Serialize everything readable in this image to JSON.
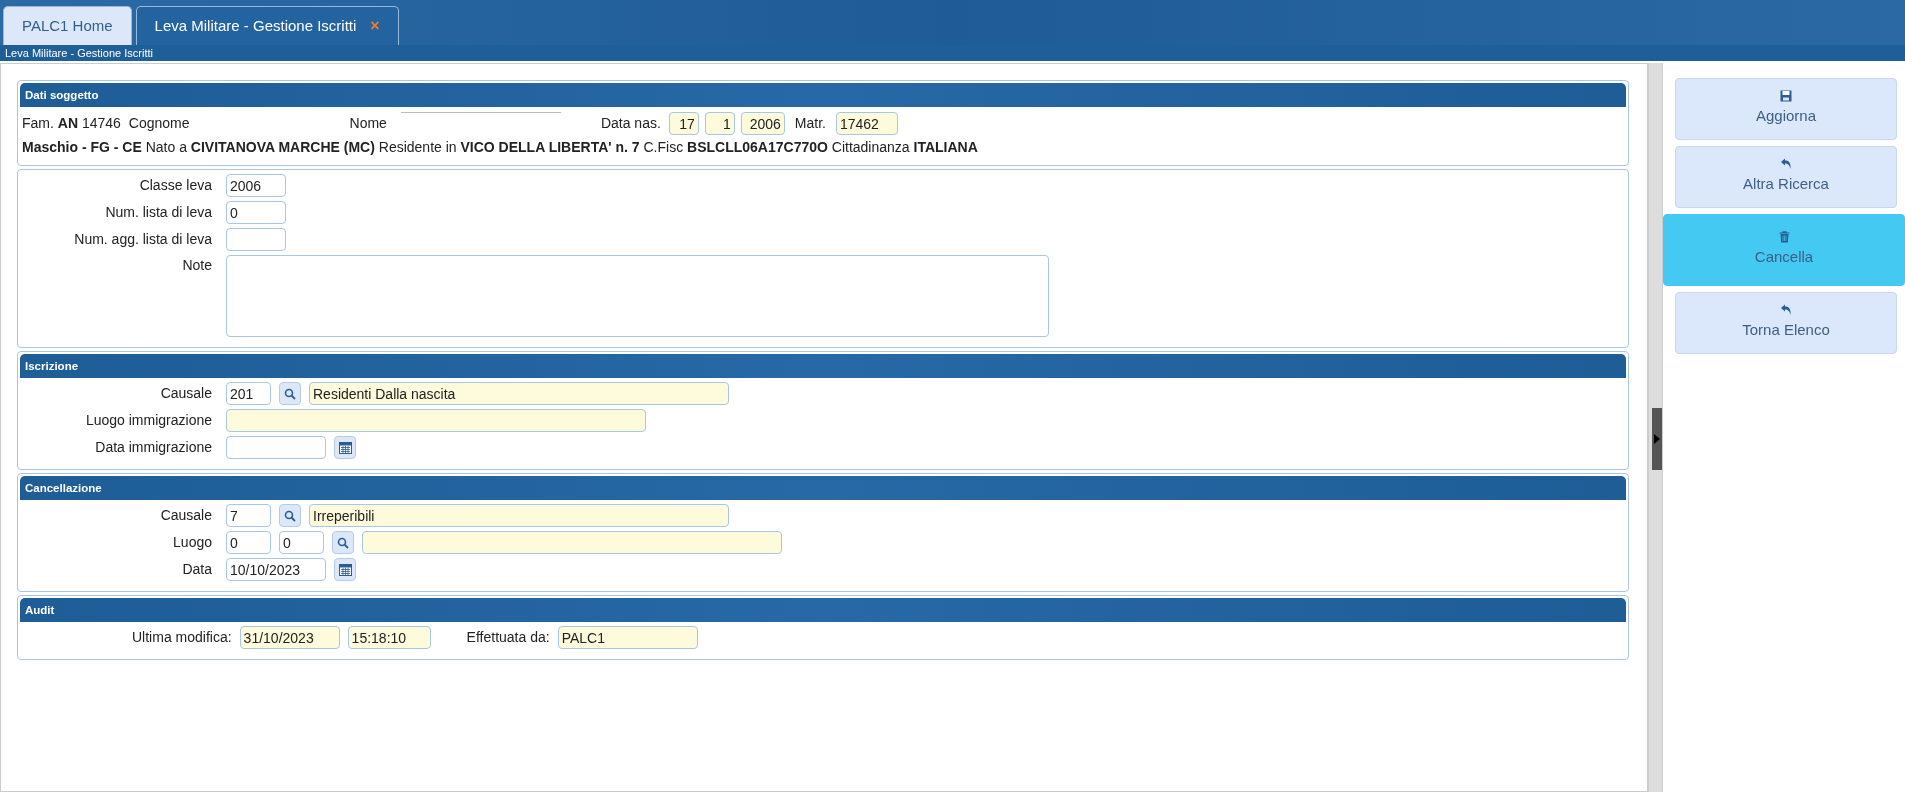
{
  "tabs": [
    {
      "label": "PALC1 Home",
      "selected": false
    },
    {
      "label": "Leva Militare - Gestione Iscritti",
      "selected": true,
      "close": "×"
    }
  ],
  "breadcrumb": "Leva Militare - Gestione Iscritti",
  "subject": {
    "title": "Dati soggetto",
    "family": "Fam. **AN** 14746",
    "surname_label": "Cognome",
    "name_label": "Nome",
    "birth_label": "Data nas.",
    "birth_fields": [
      "17",
      "1",
      "2006"
    ],
    "serial_label": "Matr.",
    "serial_value": "17462",
    "details": "**Maschio - FG - CE** Nato a **CIVITANOVA MARCHE (MC)** Residente in **VICO DELLA LIBERTA' n. 7** C.Fisc **BSLCLL06A17C770O** Cittadinanza **ITALIANA**"
  },
  "sections": [
    {
      "rows": [
        {
          "label": "Classe leva",
          "items": [
            {
              "kind": "input",
              "value": "2006",
              "readonly": false
            }
          ]
        },
        {
          "label": "Num. lista di leva",
          "items": [
            {
              "kind": "input",
              "value": "0",
              "readonly": false
            }
          ]
        },
        {
          "label": "Num. agg. lista di leva",
          "items": [
            {
              "kind": "input",
              "value": "",
              "readonly": false
            }
          ]
        },
        {
          "label": "Note",
          "items": [
            {
              "kind": "textarea",
              "value": "",
              "readonly": false
            }
          ]
        }
      ]
    },
    {
      "title": "Iscrizione",
      "rows": [
        {
          "label": "Causale",
          "items": [
            {
              "kind": "input",
              "value": "201",
              "readonly": false
            },
            {
              "kind": "lookup"
            },
            {
              "kind": "input",
              "value": "Residenti Dalla nascita",
              "readonly": true
            }
          ]
        },
        {
          "label": "Luogo immigrazione",
          "items": [
            {
              "kind": "input",
              "value": "",
              "readonly": true
            }
          ]
        },
        {
          "label": "Data immigrazione",
          "items": [
            {
              "kind": "input",
              "value": "",
              "readonly": false
            },
            {
              "kind": "calendar"
            }
          ]
        }
      ]
    },
    {
      "title": "Cancellazione",
      "rows": [
        {
          "label": "Causale",
          "items": [
            {
              "kind": "input",
              "value": "7",
              "readonly": false
            },
            {
              "kind": "lookup"
            },
            {
              "kind": "input",
              "value": "Irreperibili",
              "readonly": true
            }
          ]
        },
        {
          "label": "Luogo",
          "items": [
            {
              "kind": "input",
              "value": "0",
              "readonly": false
            },
            {
              "kind": "input",
              "value": "0",
              "readonly": false
            },
            {
              "kind": "lookup"
            },
            {
              "kind": "input",
              "value": "",
              "readonly": true
            }
          ]
        },
        {
          "label": "Data",
          "items": [
            {
              "kind": "input",
              "value": "10/10/2023",
              "readonly": false
            },
            {
              "kind": "calendar"
            }
          ]
        }
      ]
    }
  ],
  "audit": {
    "title": "Audit",
    "modified_label": "Ultima modifica:",
    "modified_date": "31/10/2023",
    "modified_time": "15:18:10",
    "by_label": "Effettuata da:",
    "by_value": "PALC1"
  },
  "buttons": [
    {
      "label": "Aggiorna",
      "highlighted": false
    },
    {
      "label": "Altra Ricerca",
      "highlighted": false
    },
    {
      "label": "Cancella",
      "highlighted": true
    },
    {
      "label": "Torna Elenco",
      "highlighted": false
    }
  ]
}
